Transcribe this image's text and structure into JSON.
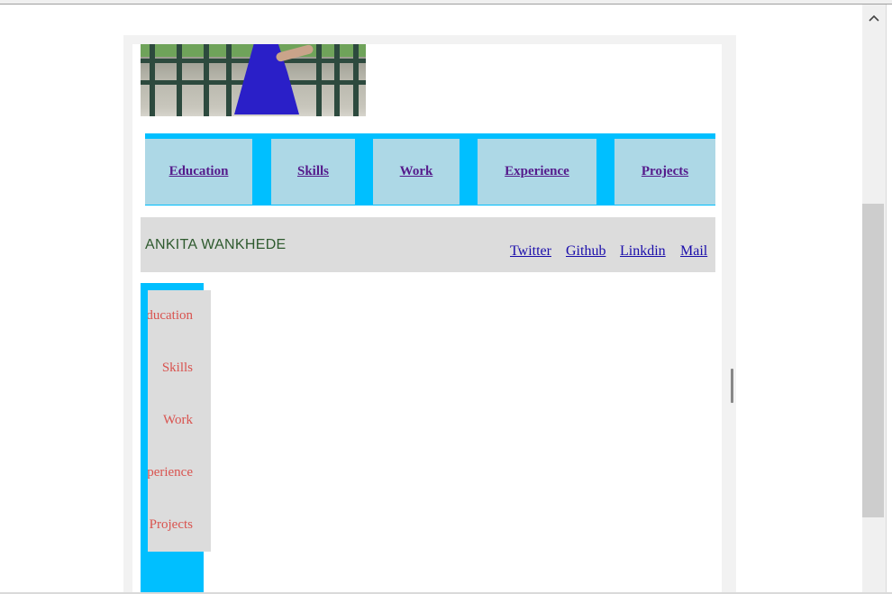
{
  "nav": {
    "items": [
      "Education",
      "Skills",
      "Work",
      "Experience",
      "Projects"
    ]
  },
  "header": {
    "name": "ANKITA WANKHEDE",
    "links": [
      "Twitter",
      "Github",
      "Linkdin",
      "Mail"
    ]
  },
  "sidebar": {
    "items": [
      "Education",
      "Skills",
      "Work",
      "Experience",
      "Projects"
    ]
  },
  "colors": {
    "nav_background": "#00bfff",
    "nav_item_background": "#add8e6",
    "header_background": "#dcdcdc",
    "sidebar_text": "#d9534f"
  },
  "icons": {
    "scroll_up": "chevron-up-icon"
  }
}
